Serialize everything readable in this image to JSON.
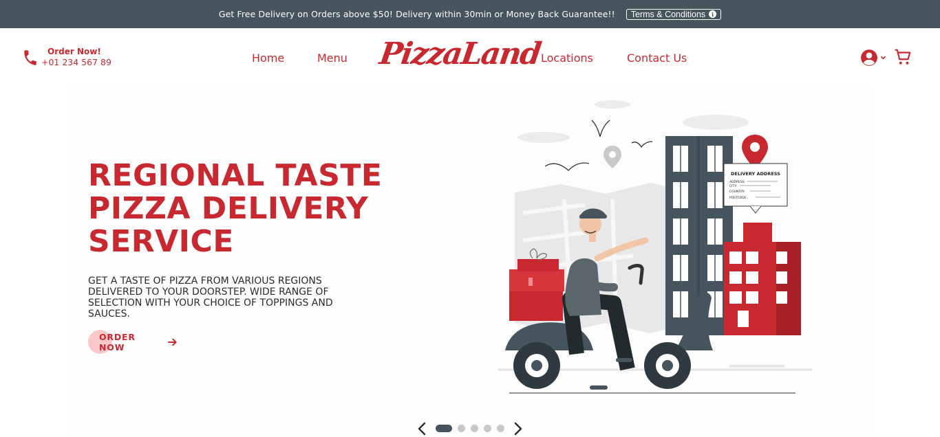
{
  "topbar": {
    "message": "Get Free Delivery on Orders above $50! Delivery within 30min or Money Back Guarantee!!",
    "terms_label": "Terms & Conditions",
    "info_glyph": "i"
  },
  "header": {
    "order_title": "Order Now!",
    "order_phone": "+01 234 567 89",
    "phone_icon": "phone-icon",
    "nav": [
      {
        "label": "Home"
      },
      {
        "label": "Menu"
      },
      {
        "label": "Locations"
      },
      {
        "label": "Contact Us"
      }
    ],
    "logo_text": "PizzaLand",
    "account_icon": "user-circle-icon",
    "cart_icon": "cart-icon"
  },
  "hero": {
    "title_lines": [
      "REGIONAL TASTE",
      "PIZZA DELIVERY",
      "SERVICE"
    ],
    "description": "GET A TASTE OF PIZZA FROM VARIOUS REGIONS DELIVERED TO YOUR DOORSTEP. WIDE RANGE OF SELECTION WITH YOUR CHOICE OF TOPPINGS AND SAUCES.",
    "cta_label": "ORDER NOW",
    "illustration": {
      "card_title": "DELIVERY ADDRESS",
      "card_fields": [
        "ADDRESS:",
        "CITY:",
        "COUNTRY:",
        "POSTCODE :"
      ]
    }
  },
  "carousel": {
    "slide_count": 5,
    "active_index": 0
  },
  "colors": {
    "brand_red": "#c8282f",
    "topbar_bg": "#46555d",
    "dark_slate": "#46555d",
    "cta_circle": "#fac8cb",
    "inactive_dot": "#c8c8c8"
  }
}
